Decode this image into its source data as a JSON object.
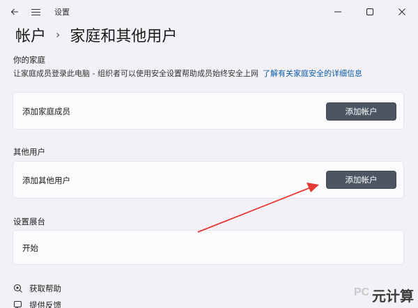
{
  "titlebar": {
    "app_title": "设置",
    "back_icon": "back-arrow-icon",
    "menu_icon": "hamburger-menu-icon",
    "minimize_icon": "minimize-icon",
    "maximize_icon": "maximize-icon",
    "close_icon": "close-icon"
  },
  "breadcrumb": {
    "parent": "帐户",
    "separator": "›",
    "current": "家庭和其他用户"
  },
  "family": {
    "section_label": "你的家庭",
    "description": "让家庭成员登录此电脑 - 组织者可以使用安全设置帮助成员始终安全上网",
    "learn_more_link": "了解有关家庭安全的详细信息",
    "add_member_label": "添加家庭成员",
    "add_account_button": "添加帐户"
  },
  "other_users": {
    "section_label": "其他用户",
    "add_other_label": "添加其他用户",
    "add_account_button": "添加帐户"
  },
  "kiosk": {
    "section_label": "设置展台",
    "start_label": "开始"
  },
  "footer": {
    "get_help": "获取帮助",
    "give_feedback": "提供反馈"
  },
  "watermark": {
    "text_main": "元计算",
    "text_prefix": "PC"
  },
  "colors": {
    "accent_button": "#4c5663",
    "link": "#0b5cad",
    "annotation_arrow": "#e53935"
  }
}
